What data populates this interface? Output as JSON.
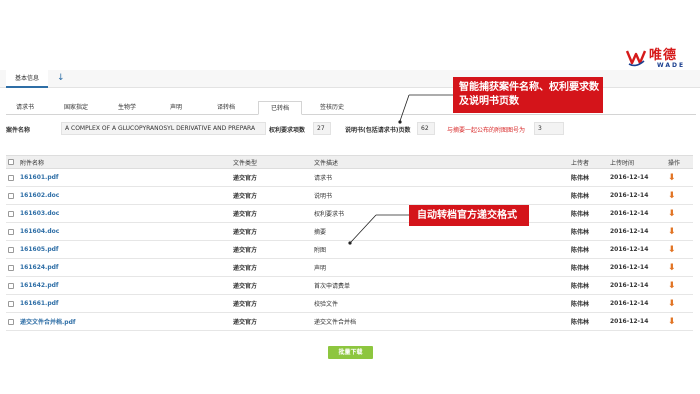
{
  "logo": {
    "cn": "唯德",
    "en": "WADE"
  },
  "topbar": {
    "basic_label": "基本信息",
    "download_icon": "↓"
  },
  "tabs": [
    "请求书",
    "国家指定",
    "生物学",
    "声明",
    "译转档",
    "已转档",
    "签核历史"
  ],
  "active_tab_index": 5,
  "meta": {
    "case_name_label": "案件名称",
    "case_name_value": "A COMPLEX OF A GLUCOPYRANOSYL DERIVATIVE AND PREPARA",
    "claims_label": "权利要求项数",
    "claims_value": "27",
    "desc_pages_label": "说明书(包括请求书)页数",
    "desc_pages_value": "62",
    "fig_label": "与摘要一起公布的附图图号为",
    "fig_value": "3"
  },
  "callouts": {
    "top": "智能捕获案件名称、权利要求数及说明书页数",
    "middle": "自动转档官方递交格式"
  },
  "table": {
    "headers": {
      "name": "附件名称",
      "type": "文件类型",
      "desc": "文件描述",
      "uploader": "上传者",
      "time": "上传时间",
      "op": "操作"
    },
    "rows": [
      {
        "name": "161601.pdf",
        "type": "递交官方",
        "desc": "请求书",
        "uploader": "陈伟林",
        "time": "2016-12-14"
      },
      {
        "name": "161602.doc",
        "type": "递交官方",
        "desc": "说明书",
        "uploader": "陈伟林",
        "time": "2016-12-14"
      },
      {
        "name": "161603.doc",
        "type": "递交官方",
        "desc": "权利要求书",
        "uploader": "陈伟林",
        "time": "2016-12-14"
      },
      {
        "name": "161604.doc",
        "type": "递交官方",
        "desc": "摘要",
        "uploader": "陈伟林",
        "time": "2016-12-14"
      },
      {
        "name": "161605.pdf",
        "type": "递交官方",
        "desc": "附图",
        "uploader": "陈伟林",
        "time": "2016-12-14"
      },
      {
        "name": "161624.pdf",
        "type": "递交官方",
        "desc": "声明",
        "uploader": "陈伟林",
        "time": "2016-12-14"
      },
      {
        "name": "161642.pdf",
        "type": "递交官方",
        "desc": "首次申请费单",
        "uploader": "陈伟林",
        "time": "2016-12-14"
      },
      {
        "name": "161661.pdf",
        "type": "递交官方",
        "desc": "校验文件",
        "uploader": "陈伟林",
        "time": "2016-12-14"
      },
      {
        "name": "递交文件合并档.pdf",
        "type": "递交官方",
        "desc": "递交文件合并档",
        "uploader": "陈伟林",
        "time": "2016-12-14"
      }
    ]
  },
  "batch_download_label": "批量下载",
  "colors": {
    "accent_blue": "#2e6ea6",
    "callout_red": "#d4141a",
    "download_orange": "#e27424",
    "batch_green": "#8dc63f"
  }
}
